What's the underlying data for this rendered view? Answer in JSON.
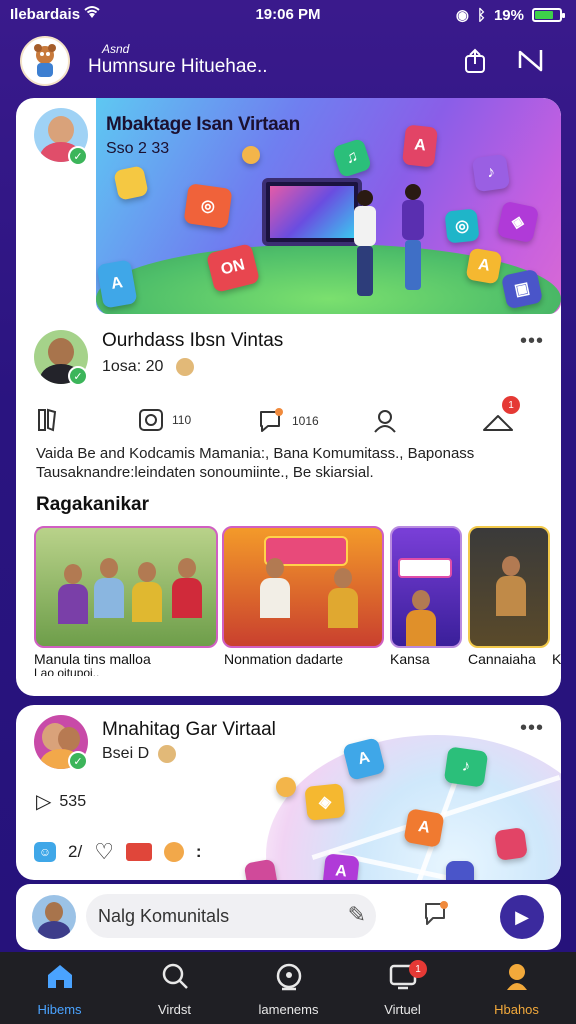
{
  "status_bar": {
    "carrier": "Ilebardais",
    "time": "19:06 PM",
    "battery": "19%"
  },
  "header": {
    "small_name": "Asnd",
    "title": "Humnsure Hituehae.."
  },
  "post1": {
    "hero_title": "Mbaktage Isan Virtaan",
    "hero_sub": "Sso 2 33"
  },
  "post2": {
    "name": "Ourhdass Ibsn Vintas",
    "meta": "1osa: 20",
    "actions": {
      "comments": "1016",
      "views": "110",
      "alert_count": "1"
    },
    "description": "Vaida Be and Kodcamis Mamania:, Bana Komumitass., Baponass Tausaknandre:leindaten sonoumiinte., Be skiarsial.",
    "section_title": "Ragakanikar",
    "thumbs": [
      {
        "label": "Manula tins malloa",
        "label2": "Lao oitupoi.."
      },
      {
        "label": "Nonmation dadarte"
      },
      {
        "label": "Kansa"
      },
      {
        "label": "Cannaiaha"
      },
      {
        "label": "K"
      }
    ]
  },
  "post3": {
    "name": "Mnahitag Gar Virtaal",
    "meta": "Bsei D",
    "plays": "535",
    "reactions": "2/"
  },
  "compose": {
    "placeholder": "Nalg Komunitals"
  },
  "tabs": [
    {
      "label": "Hibems",
      "icon": "home-icon",
      "color": "#4aa3ff"
    },
    {
      "label": "Virdst",
      "icon": "search-icon"
    },
    {
      "label": "lamenems",
      "icon": "community-icon"
    },
    {
      "label": "Virtuel",
      "icon": "live-icon",
      "badge": "1"
    },
    {
      "label": "Hbahos",
      "icon": "profile-icon",
      "color": "#f2a93b"
    }
  ],
  "colors": {
    "accent": "#3b2a9e",
    "background": "#2a1480",
    "badge": "#e53935",
    "verified": "#3cb55a"
  }
}
